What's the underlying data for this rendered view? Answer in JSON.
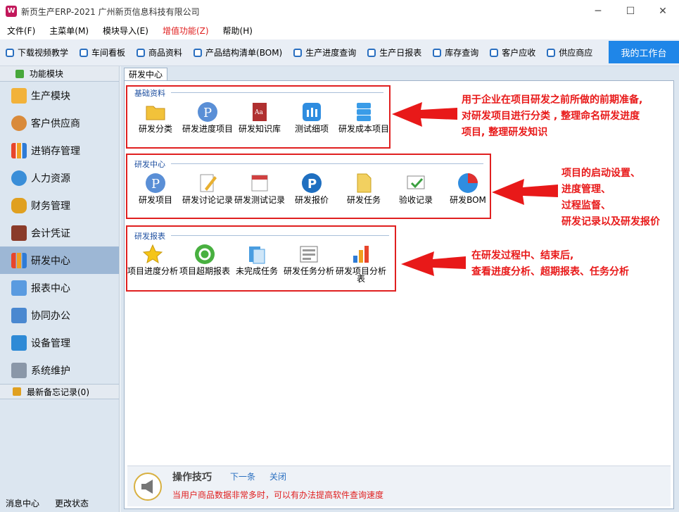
{
  "window": {
    "title": "新页生产ERP-2021 广州新页信息科技有限公司",
    "app_icon_glyph": "W",
    "controls": [
      "─",
      "☐",
      "✕"
    ]
  },
  "menu": [
    "文件(F)",
    "主菜单(M)",
    "模块导入(E)",
    "增值功能(Z)",
    "帮助(H)"
  ],
  "menu_highlight_color": "#e02020",
  "toolbar": {
    "items": [
      "下载视频教学",
      "车间看板",
      "商品资料",
      "产品结构清单(BOM)",
      "生产进度查询",
      "生产日报表",
      "库存查询",
      "客户应收",
      "供应商应"
    ],
    "workbench_label": "我的工作台"
  },
  "sidebar": {
    "header": "功能模块",
    "items": [
      {
        "label": "生产模块",
        "icon": "folder-icon"
      },
      {
        "label": "客户供应商",
        "icon": "people-icon"
      },
      {
        "label": "进销存管理",
        "icon": "bar-chart-icon"
      },
      {
        "label": "人力资源",
        "icon": "person-icon"
      },
      {
        "label": "财务管理",
        "icon": "money-bag-icon"
      },
      {
        "label": "会计凭证",
        "icon": "ledger-icon"
      },
      {
        "label": "研发中心",
        "icon": "chart-icon"
      },
      {
        "label": "报表中心",
        "icon": "report-icon"
      },
      {
        "label": "协同办公",
        "icon": "calendar-icon"
      },
      {
        "label": "设备管理",
        "icon": "device-icon"
      },
      {
        "label": "系统维护",
        "icon": "lock-icon"
      }
    ],
    "active_index": 6,
    "memo": "最新备忘记录(0)",
    "footer": [
      "消息中心",
      "更改状态"
    ]
  },
  "tab": "研发中心",
  "groups": [
    {
      "title": "基础资料",
      "items": [
        "研发分类",
        "研发进度项目",
        "研发知识库",
        "测试细项",
        "研发成本项目"
      ]
    },
    {
      "title": "研发中心",
      "items": [
        "研发项目",
        "研发讨论记录",
        "研发测试记录",
        "研发报价",
        "研发任务",
        "验收记录",
        "研发BOM"
      ]
    },
    {
      "title": "研发报表",
      "items": [
        "项目进度分析",
        "项目超期报表",
        "未完成任务",
        "研发任务分析",
        "研发项目分析表"
      ]
    }
  ],
  "annotations": [
    [
      "用于企业在项目研发之前所做的前期准备,",
      "对研发项目进行分类 , 整理命名研发进度",
      "项目, 整理研发知识"
    ],
    [
      "项目的启动设置、",
      "进度管理、",
      "过程监督、",
      "研发记录以及研发报价"
    ],
    [
      "在研发过程中、结束后,",
      "查看进度分析、超期报表、任务分析"
    ]
  ],
  "tips": {
    "title": "操作技巧",
    "next": "下一条",
    "close": "关闭",
    "message": "当用户商品数据非常多时，可以有办法提高软件查询速度"
  }
}
